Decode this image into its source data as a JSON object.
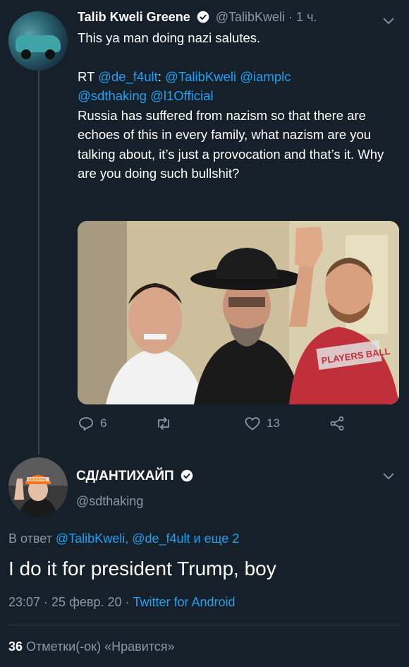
{
  "tweet1": {
    "name": "Talib Kweli Greene",
    "handle": "@TalibKweli",
    "time": " · 1 ч.",
    "comment": "This ya man doing nazi salutes.",
    "rt_prefix": "RT ",
    "rt_mention_1": "@de_f4ult",
    "rt_colon": ": ",
    "rt_mention_2": "@TalibKweli",
    "rt_mention_3": "@iamplc",
    "rt_mention_4": "@sdthaking",
    "rt_mention_5": "@l1Official",
    "quote": "Russia has suffered from nazism so that there are echoes of this in every family, what nazism are you talking about, it’s just a provocation and that’s it. Why are you doing such bullshit?",
    "photo_text": "PLAYERS BALL",
    "replies": "6",
    "likes": "13"
  },
  "tweet2": {
    "name": "СД/АНТИХАЙП",
    "handle": "@sdthaking",
    "avatar_cap_text": "ANTIHYPE",
    "reply_prefix": "В ответ ",
    "reply_mention_1": "@TalibKweli",
    "reply_sep": ", ",
    "reply_mention_2": "@de_f4ult",
    "reply_suffix": " и еще 2",
    "text": "I do it for president Trump, boy",
    "time_date": "23:07 · 25 февр. 20 · ",
    "client": "Twitter for Android",
    "likes_count": "36",
    "likes_label": " Отметки(-ок) «Нравится»"
  },
  "colors": {
    "background": "#15202b",
    "accent": "#1da1f2",
    "secondary": "#8899a6",
    "divider": "#38444d"
  },
  "icons": [
    "verified-badge-icon",
    "chevron-down-icon",
    "reply-icon",
    "retweet-icon",
    "like-icon",
    "share-icon"
  ]
}
